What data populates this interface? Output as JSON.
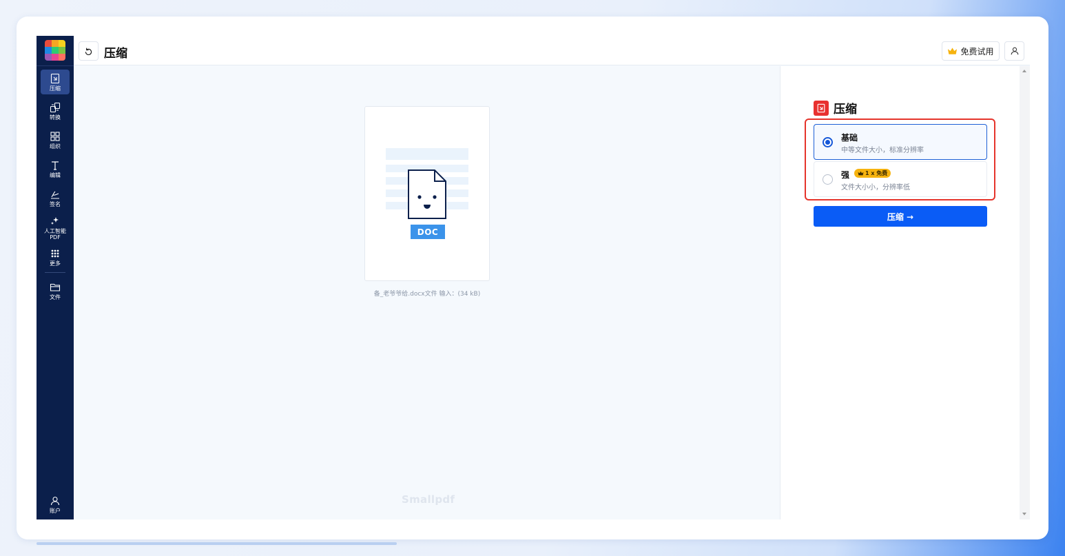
{
  "header": {
    "title": "压缩",
    "trial_label": "免费试用"
  },
  "sidebar": {
    "items": [
      {
        "label": "压缩",
        "icon": "compress-icon",
        "active": true
      },
      {
        "label": "转换",
        "icon": "convert-icon"
      },
      {
        "label": "组织",
        "icon": "organize-icon"
      },
      {
        "label": "编辑",
        "icon": "edit-text-icon"
      },
      {
        "label": "签名",
        "icon": "sign-icon"
      },
      {
        "label": "人工智能",
        "label2": "PDF",
        "icon": "ai-sparkle-icon"
      },
      {
        "label": "更多",
        "icon": "grid-more-icon"
      },
      {
        "label": "文件",
        "icon": "folder-icon"
      }
    ],
    "account_label": "账户"
  },
  "preview": {
    "file_type_badge": "DOC",
    "file_caption": "备_老爷爷给.docx文件 输入：(34 kB)",
    "watermark": "Smallpdf"
  },
  "panel": {
    "title": "压缩",
    "options": [
      {
        "title": "基础",
        "description": "中等文件大小，标准分辨率",
        "selected": true
      },
      {
        "title": "强",
        "description": "文件大小小，分辨率低",
        "selected": false,
        "badge": "1 x 免费"
      }
    ],
    "compress_button": "压缩 →"
  },
  "colors": {
    "sidebar_bg": "#0b1f4b",
    "accent_blue": "#0a5cf6",
    "highlight_red": "#e5332a",
    "badge_gold": "#f6b30f"
  }
}
